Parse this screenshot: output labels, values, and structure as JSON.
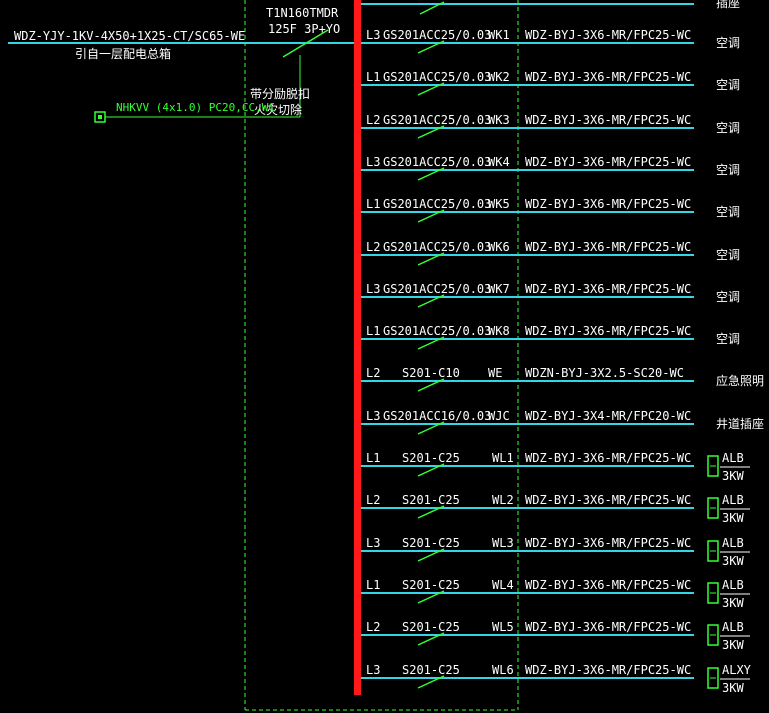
{
  "colors": {
    "background": "#000000",
    "bus": "#ff1a1a",
    "feeder": "#33d6e6",
    "breaker": "#33ff33",
    "fire_control": "#33ff33",
    "text": "#ffffff",
    "dashed_box": "#33ff33"
  },
  "incoming": {
    "cable": "WDZ-YJY-1KV-4X50+1X25-CT/SC65-WE",
    "source": "引自一层配电总箱"
  },
  "main_breaker": {
    "model": "T1N160TMDR",
    "rating": "125F 3P+YO",
    "note_line1": "带分励脱扣",
    "note_line2": "火灾切除"
  },
  "fire_signal": {
    "cable": "NHKVV (4x1.0) PC20,CC,WC",
    "icon": "fire-control-module-icon"
  },
  "top_partial": {
    "label": "插座"
  },
  "circuits": [
    {
      "phase": "L3",
      "breaker": "GS201ACC25/0.03",
      "id": "WK1",
      "cable": "WDZ-BYJ-3X6-MR/FPC25-WC",
      "load": "空调",
      "load_type": "text"
    },
    {
      "phase": "L1",
      "breaker": "GS201ACC25/0.03",
      "id": "WK2",
      "cable": "WDZ-BYJ-3X6-MR/FPC25-WC",
      "load": "空调",
      "load_type": "text"
    },
    {
      "phase": "L2",
      "breaker": "GS201ACC25/0.03",
      "id": "WK3",
      "cable": "WDZ-BYJ-3X6-MR/FPC25-WC",
      "load": "空调",
      "load_type": "text"
    },
    {
      "phase": "L3",
      "breaker": "GS201ACC25/0.03",
      "id": "WK4",
      "cable": "WDZ-BYJ-3X6-MR/FPC25-WC",
      "load": "空调",
      "load_type": "text"
    },
    {
      "phase": "L1",
      "breaker": "GS201ACC25/0.03",
      "id": "WK5",
      "cable": "WDZ-BYJ-3X6-MR/FPC25-WC",
      "load": "空调",
      "load_type": "text"
    },
    {
      "phase": "L2",
      "breaker": "GS201ACC25/0.03",
      "id": "WK6",
      "cable": "WDZ-BYJ-3X6-MR/FPC25-WC",
      "load": "空调",
      "load_type": "text"
    },
    {
      "phase": "L3",
      "breaker": "GS201ACC25/0.03",
      "id": "WK7",
      "cable": "WDZ-BYJ-3X6-MR/FPC25-WC",
      "load": "空调",
      "load_type": "text"
    },
    {
      "phase": "L1",
      "breaker": "GS201ACC25/0.03",
      "id": "WK8",
      "cable": "WDZ-BYJ-3X6-MR/FPC25-WC",
      "load": "空调",
      "load_type": "text"
    },
    {
      "phase": "L2",
      "breaker": "S201-C10",
      "id": "WE",
      "cable": "WDZN-BYJ-3X2.5-SC20-WC",
      "load": "应急照明",
      "load_type": "text"
    },
    {
      "phase": "L3",
      "breaker": "GS201ACC16/0.03",
      "id": "WJC",
      "cable": "WDZ-BYJ-3X4-MR/FPC20-WC",
      "load": "井道插座",
      "load_type": "text"
    },
    {
      "phase": "L1",
      "breaker": "S201-C25",
      "id": "WL1",
      "cable": "WDZ-BYJ-3X6-MR/FPC25-WC",
      "load": "ALB",
      "power": "3KW",
      "load_type": "box"
    },
    {
      "phase": "L2",
      "breaker": "S201-C25",
      "id": "WL2",
      "cable": "WDZ-BYJ-3X6-MR/FPC25-WC",
      "load": "ALB",
      "power": "3KW",
      "load_type": "box"
    },
    {
      "phase": "L3",
      "breaker": "S201-C25",
      "id": "WL3",
      "cable": "WDZ-BYJ-3X6-MR/FPC25-WC",
      "load": "ALB",
      "power": "3KW",
      "load_type": "box"
    },
    {
      "phase": "L1",
      "breaker": "S201-C25",
      "id": "WL4",
      "cable": "WDZ-BYJ-3X6-MR/FPC25-WC",
      "load": "ALB",
      "power": "3KW",
      "load_type": "box"
    },
    {
      "phase": "L2",
      "breaker": "S201-C25",
      "id": "WL5",
      "cable": "WDZ-BYJ-3X6-MR/FPC25-WC",
      "load": "ALB",
      "power": "3KW",
      "load_type": "box"
    },
    {
      "phase": "L3",
      "breaker": "S201-C25",
      "id": "WL6",
      "cable": "WDZ-BYJ-3X6-MR/FPC25-WC",
      "load": "ALXY",
      "power": "3KW",
      "load_type": "box"
    }
  ]
}
